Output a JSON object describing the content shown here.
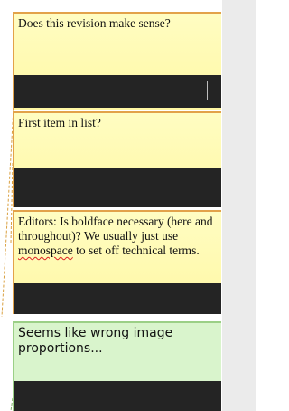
{
  "comments": [
    {
      "id": "c1",
      "text": "Does this revision make sense?",
      "color": "#fff7a4",
      "border_color": "#e2a24a"
    },
    {
      "id": "c2",
      "text": "First item in list?",
      "color": "#fff7a4",
      "border_color": "#e2a24a"
    },
    {
      "id": "c3",
      "text_before": "Editors: Is boldface necessary (here and throughout)? We usually just use ",
      "text_misspelled": "monospace",
      "text_after": " to set off technical terms.",
      "color": "#fff7a4",
      "border_color": "#e2a24a"
    },
    {
      "id": "c4",
      "text": "Seems like wrong image proportions...",
      "color": "#d9f4cc",
      "border_color": "#9bcf86"
    }
  ],
  "colors": {
    "panel_background": "#ebebeb",
    "reply_bar": "#242424",
    "spellcheck_underline": "#dd2222"
  }
}
